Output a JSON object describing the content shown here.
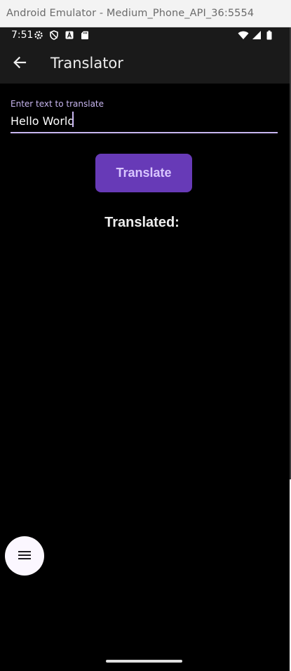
{
  "window": {
    "title": "Android Emulator - Medium_Phone_API_36:5554"
  },
  "status_bar": {
    "time": "7:51",
    "left_icons": [
      "settings-icon",
      "shield-icon",
      "a-icon",
      "sd-card-icon"
    ],
    "right_icons": [
      "wifi-icon",
      "signal-icon",
      "battery-icon"
    ]
  },
  "app_bar": {
    "title": "Translator",
    "back_icon": "arrow-back-icon"
  },
  "input": {
    "label": "Enter text to translate",
    "value": "Hello World"
  },
  "translate_button": {
    "label": "Translate"
  },
  "result": {
    "label": "Translated:"
  },
  "fab": {
    "icon": "menu-icon"
  },
  "colors": {
    "accent": "#673ab7",
    "label_accent": "#c8b6f0",
    "background": "#000000",
    "app_bar": "#1a1a1a"
  }
}
